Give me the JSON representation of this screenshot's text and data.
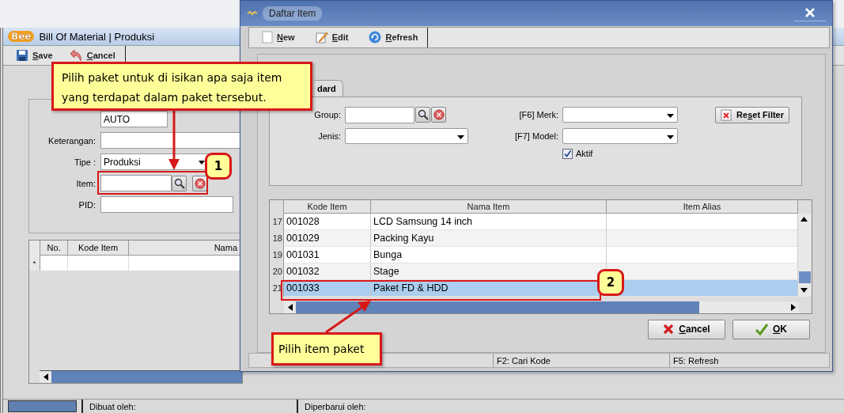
{
  "main_window": {
    "logo": "Bee",
    "title": "Bill Of Material | Produksi",
    "toolbar": [
      {
        "label": "Save"
      },
      {
        "label": "Cancel"
      }
    ],
    "code_value": "AUTO",
    "fields": [
      {
        "kind": "text",
        "label": "Keterangan:"
      },
      {
        "kind": "select",
        "label": "Tipe :",
        "value": "Produksi"
      },
      {
        "kind": "lookup",
        "label": "Item:"
      },
      {
        "kind": "text",
        "label": "PID:"
      }
    ],
    "grid": {
      "columns": [
        "No.",
        "Kode Item",
        "Nama"
      ],
      "new_row_marker": "*"
    },
    "status_bar": [
      "Dibuat oleh:",
      "Diperbarui oleh:"
    ]
  },
  "dialog": {
    "title": "Daftar Item",
    "toolbar": [
      {
        "label": "New"
      },
      {
        "label": "Edit"
      },
      {
        "label": "Refresh"
      }
    ],
    "tab": {
      "label": "dard",
      "selected": true
    },
    "filters": {
      "group": "Group:",
      "jenis": "Jenis:",
      "merk": "[F6] Merk:",
      "model": "[F7] Model:",
      "aktif": {
        "label": "Aktif",
        "checked": true
      },
      "reset": {
        "label": "Reset Filter"
      }
    },
    "table": {
      "columns": [
        "Kode Item",
        "Nama Item",
        "Item Alias"
      ],
      "rows": [
        {
          "number": "17",
          "code": "001028",
          "name": "LCD Samsung 14 inch",
          "selected": false
        },
        {
          "number": "18",
          "code": "001029",
          "name": "Packing Kayu",
          "selected": false
        },
        {
          "number": "19",
          "code": "001031",
          "name": "Bunga",
          "selected": false
        },
        {
          "number": "20",
          "code": "001032",
          "name": "Stage",
          "selected": false
        },
        {
          "number": "21",
          "code": "001033",
          "name": "Paket FD & HDD",
          "selected": true
        }
      ]
    },
    "buttons": [
      {
        "label": "Cancel"
      },
      {
        "label": "OK"
      }
    ],
    "status_bar": [
      "F2: Cari Kode",
      "F5: Refresh"
    ]
  },
  "callouts": [
    {
      "text": "Pilih paket untuk di isikan apa saja item yang terdapat dalam paket tersebut.",
      "badge": "1"
    },
    {
      "text": "Pilih item paket",
      "badge": "2"
    }
  ]
}
